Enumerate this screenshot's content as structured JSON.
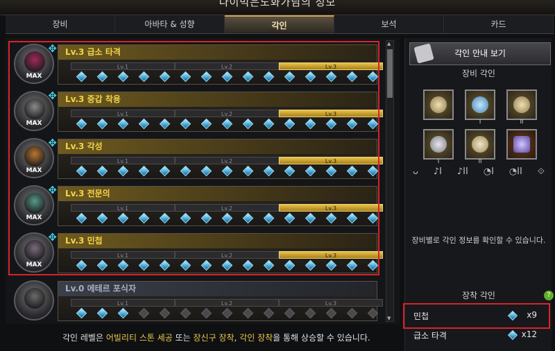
{
  "window": {
    "title": "나이먹은노화가님의 정보"
  },
  "tabs": [
    "장비",
    "아바타 & 성향",
    "각인",
    "보석",
    "카드"
  ],
  "active_tab": 2,
  "engravings": [
    {
      "name": "Lv.3 급소 타격",
      "max_label": "MAX",
      "active_levels": 3,
      "face_color": "#a02a5a"
    },
    {
      "name": "Lv.3 중갑 착용",
      "max_label": "MAX",
      "active_levels": 3,
      "face_color": "#8a8a8a"
    },
    {
      "name": "Lv.3 각성",
      "max_label": "MAX",
      "active_levels": 3,
      "face_color": "#b87830"
    },
    {
      "name": "Lv.3 전문의",
      "max_label": "MAX",
      "active_levels": 3,
      "face_color": "#5a9a8a"
    },
    {
      "name": "Lv.3 민첩",
      "max_label": "MAX",
      "active_levels": 3,
      "face_color": "#7a6a7a"
    },
    {
      "name": "Lv.0 에테르 포식자",
      "max_label": "",
      "active_levels": 0,
      "face_color": "#6a6a6a"
    }
  ],
  "level_labels": [
    "Lv.1",
    "Lv.2",
    "Lv.3"
  ],
  "footer": {
    "prefix": "각인 레벨은 ",
    "hl1": "어빌리티 스톤 세공",
    "mid1": " 또는 ",
    "hl2": "장신구 장착",
    "mid2": ", ",
    "hl3": "각인 장착",
    "suffix": "을 통해 상승할 수 있습니다."
  },
  "right": {
    "guide_button": "각인 안내 보기",
    "equip_title": "장비 각인",
    "slot_roman": [
      "",
      "I",
      "II",
      "I",
      "II",
      ""
    ],
    "filter_icons": [
      "necklace-icon",
      "earring-1-icon",
      "earring-2-icon",
      "ring-1-icon",
      "ring-2-icon",
      "stone-icon"
    ],
    "filter_glyphs": [
      "ᴗ",
      "♪I",
      "♪II",
      "◔I",
      "◔II",
      "⟐"
    ],
    "info_text": "장비별로 각인 정보를 확인할 수 있습니다.",
    "worn_title": "장착 각인",
    "help": "?",
    "worn": [
      {
        "name": "민첩",
        "count": "x9"
      },
      {
        "name": "급소 타격",
        "count": "x12"
      }
    ]
  },
  "colors": {
    "accent": "#e9c84a",
    "highlight_red": "#d8242a",
    "gem": "#3fa3d6"
  }
}
